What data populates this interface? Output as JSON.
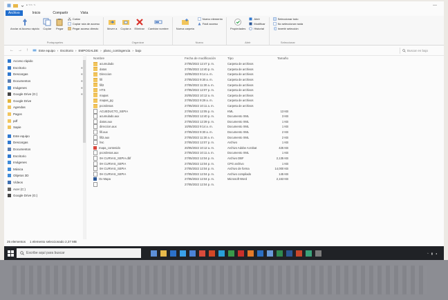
{
  "window": {
    "title": "• ~~ ~",
    "minimize_glyph": "—"
  },
  "tabs": [
    "Archivo",
    "Inicio",
    "Compartir",
    "Vista"
  ],
  "ribbon": {
    "clipboard": {
      "big": [
        "Anclar al Acceso rápido",
        "Copiar",
        "Pegar"
      ],
      "small": [
        "Cortar",
        "Copiar ruta de acceso",
        "Pegar acceso directo"
      ],
      "label": "Portapapeles"
    },
    "organize": {
      "big": [
        "Mover a",
        "Copiar a",
        "Eliminar",
        "Cambiar nombre"
      ],
      "label": "Organizar"
    },
    "new": {
      "big": [
        "Nueva carpeta"
      ],
      "small": [
        "Nuevo elemento",
        "Fácil acceso"
      ],
      "label": "Nuevo"
    },
    "open": {
      "big": [
        "Propiedades"
      ],
      "small": [
        "Abrir",
        "Modificar",
        "Historial"
      ],
      "label": "Abrir"
    },
    "select": {
      "small": [
        "Seleccionar todo",
        "No seleccionar nada",
        "Invertir selección"
      ],
      "label": "Seleccionar"
    }
  },
  "address": {
    "back": "←",
    "forward": "→",
    "up": "↑",
    "path": [
      "Este equipo",
      "Escritorio",
      "EMPOGALDE",
      "plano_contingencia",
      "bajo"
    ],
    "search_placeholder": "Buscar en bajo"
  },
  "nav": [
    {
      "label": "Acceso rápido",
      "icon": "star-icon",
      "color": "#2f78d0",
      "pinned": false
    },
    {
      "label": "Escritorio",
      "icon": "desktop-icon",
      "color": "#2f78d0",
      "pinned": true
    },
    {
      "label": "Descargas",
      "icon": "download-icon",
      "color": "#2f78d0",
      "pinned": true
    },
    {
      "label": "Documentos",
      "icon": "document-icon",
      "color": "#5a7fb5",
      "pinned": true
    },
    {
      "label": "Imágenes",
      "icon": "picture-icon",
      "color": "#3f8bd9",
      "pinned": true
    },
    {
      "label": "Google Drive (G:)",
      "icon": "drive-icon",
      "color": "#444",
      "pinned": true
    },
    {
      "label": "Google Drive",
      "icon": "google-drive-icon",
      "color": "#e4b43a",
      "pinned": false
    },
    {
      "label": "Agendas",
      "icon": "folder-icon",
      "color": "#f2c55c",
      "pinned": false
    },
    {
      "label": "Pagos",
      "icon": "folder-icon",
      "color": "#f2c55c",
      "pinned": false
    },
    {
      "label": "pdf",
      "icon": "folder-icon",
      "color": "#f2c55c",
      "pinned": false
    },
    {
      "label": "Sapie",
      "icon": "folder-icon",
      "color": "#f2c55c",
      "pinned": false
    },
    {
      "label": "Este equipo",
      "icon": "computer-icon",
      "color": "#2f78d0",
      "pinned": false
    },
    {
      "label": "Descargas",
      "icon": "download-icon",
      "color": "#2f78d0",
      "pinned": false
    },
    {
      "label": "Documentos",
      "icon": "document-icon",
      "color": "#5a7fb5",
      "pinned": false
    },
    {
      "label": "Escritorio",
      "icon": "desktop-icon",
      "color": "#2f78d0",
      "pinned": false
    },
    {
      "label": "Imágenes",
      "icon": "picture-icon",
      "color": "#3f8bd9",
      "pinned": false
    },
    {
      "label": "Música",
      "icon": "music-icon",
      "color": "#3f8bd9",
      "pinned": false
    },
    {
      "label": "Objetos 3D",
      "icon": "cube-icon",
      "color": "#3f8bd9",
      "pinned": false
    },
    {
      "label": "Vídeos",
      "icon": "video-icon",
      "color": "#3f6fb0",
      "pinned": false
    },
    {
      "label": "Acer (C:)",
      "icon": "disk-icon",
      "color": "#666",
      "pinned": false
    },
    {
      "label": "Google Drive (G:)",
      "icon": "drive-icon",
      "color": "#444",
      "pinned": false
    }
  ],
  "columns": {
    "name": "Nombre",
    "date": "Fecha de modificación",
    "type": "Tipo",
    "size": "Tamaño"
  },
  "files": [
    {
      "name": "acumulado",
      "date": "27/05/2022 12:47 p. m.",
      "type": "Carpeta de archivos",
      "size": "",
      "kind": "folder"
    },
    {
      "name": "datos",
      "date": "27/05/2022 12:40 p. m.",
      "type": "Carpeta de archivos",
      "size": "",
      "kind": "folder"
    },
    {
      "name": "Direccion",
      "date": "10/05/2022 9:14 a. m.",
      "type": "Carpeta de archivos",
      "size": "",
      "kind": "folder"
    },
    {
      "name": "fill",
      "date": "27/05/2022 9:30 a. m.",
      "type": "Carpeta de archivos",
      "size": "",
      "kind": "folder"
    },
    {
      "name": "fill2",
      "date": "27/05/2022 11:30 a. m.",
      "type": "Carpeta de archivos",
      "size": "",
      "kind": "folder"
    },
    {
      "name": "HTS",
      "date": "27/05/2022 12:07 p. m.",
      "type": "Carpeta de archivos",
      "size": "",
      "kind": "folder"
    },
    {
      "name": "mapas",
      "date": "20/05/2022 10:12 a. m.",
      "type": "Carpeta de archivos",
      "size": "",
      "kind": "folder"
    },
    {
      "name": "mapas_pg",
      "date": "27/05/2022 9:29 a. m.",
      "type": "Carpeta de archivos",
      "size": "",
      "kind": "folder"
    },
    {
      "name": "pcordenas",
      "date": "27/05/2022 10:11 a. m.",
      "type": "Carpeta de archivos",
      "size": "",
      "kind": "folder"
    },
    {
      "name": "ACUEDUCTO_SEPIA",
      "date": "27/05/2022 12:05 p. m.",
      "type": "KML",
      "size": "13 KB",
      "kind": "file"
    },
    {
      "name": "acumulado.aux",
      "date": "27/05/2022 12:40 p. m.",
      "type": "Documento XML",
      "size": "3 KB",
      "kind": "file"
    },
    {
      "name": "datos.aux",
      "date": "27/05/2022 12:39 p. m.",
      "type": "Documento XML",
      "size": "1 KB",
      "kind": "file"
    },
    {
      "name": "direccion.aux",
      "date": "10/05/2022 9:14 a. m.",
      "type": "Documento XML",
      "size": "1 KB",
      "kind": "file"
    },
    {
      "name": "fill.aux",
      "date": "27/05/2022 9:30 a. m.",
      "type": "Documento XML",
      "size": "2 KB",
      "kind": "file"
    },
    {
      "name": "fill2.aux",
      "date": "27/05/2022 11:30 a. m.",
      "type": "Documento XML",
      "size": "2 KB",
      "kind": "file"
    },
    {
      "name": "hsc",
      "date": "27/05/2022 12:07 p. m.",
      "type": "Archivo",
      "size": "1 KB",
      "kind": "file"
    },
    {
      "name": "mapa_contenido",
      "date": "20/05/2022 10:12 a. m.",
      "type": "Archivo Adobe Acrobat",
      "size": "425 KB",
      "kind": "pdf"
    },
    {
      "name": "pcordenas.aux",
      "date": "27/05/2022 10:11 a. m.",
      "type": "Documento XML",
      "size": "1 KB",
      "kind": "file"
    },
    {
      "name": "0H CURVAS_SEPIA.dbf",
      "date": "27/05/2022 12:04 p. m.",
      "type": "Archivo DBF",
      "size": "2,135 KB",
      "kind": "file"
    },
    {
      "name": "0H CURVAS_SEPIA",
      "date": "27/05/2022 12:04 p. m.",
      "type": "CPG archivo",
      "size": "1 KB",
      "kind": "file"
    },
    {
      "name": "0H CURVAS_SEPIA",
      "date": "27/05/2022 12:04 p. m.",
      "type": "Archivo de forma",
      "size": "14,000 KB",
      "kind": "file"
    },
    {
      "name": "0H CURVAS_SEPIA",
      "date": "27/05/2022 12:04 p. m.",
      "type": "Archivo compilado",
      "size": "145 KB",
      "kind": "file"
    },
    {
      "name": "Ox Mapa",
      "date": "27/05/2022 12:04 p. m.",
      "type": "Microsoft Word",
      "size": "2,163 KB",
      "kind": "word"
    },
    {
      "name": "",
      "date": "27/05/2022 12:04 p. m.",
      "type": "",
      "size": "",
      "kind": "file"
    }
  ],
  "status": {
    "count": "25 elementos",
    "selected": "1 elemento seleccionado  2,37 MB"
  },
  "taskbar": {
    "search_placeholder": "Escribe aquí para buscar",
    "apps": [
      {
        "icon": "task-view-icon",
        "color": "#5d8fd8"
      },
      {
        "icon": "explorer-icon",
        "color": "#e7b94b"
      },
      {
        "icon": "mail-icon",
        "color": "#2c71c9"
      },
      {
        "icon": "edge-icon",
        "color": "#3aa0e8"
      },
      {
        "icon": "store-icon",
        "color": "#4b83d6"
      },
      {
        "icon": "chrome-icon",
        "color": "#d94b3b"
      },
      {
        "icon": "office-icon",
        "color": "#d24726"
      },
      {
        "icon": "photos-icon",
        "color": "#2aa0d8"
      },
      {
        "icon": "earth-icon",
        "color": "#3a9a4a"
      },
      {
        "icon": "acrobat-icon",
        "color": "#c8302b"
      },
      {
        "icon": "firefox-icon",
        "color": "#e27a2a"
      },
      {
        "icon": "outlook-icon",
        "color": "#2b6fc2"
      },
      {
        "icon": "settings-icon",
        "color": "#6a9bd8"
      },
      {
        "icon": "excel-icon",
        "color": "#2f8a4f"
      },
      {
        "icon": "word-icon",
        "color": "#2b5797"
      },
      {
        "icon": "powerpoint-icon",
        "color": "#c9472b"
      },
      {
        "icon": "maps-icon",
        "color": "#3aa37a"
      },
      {
        "icon": "app-icon",
        "color": "#7b7b7b"
      }
    ]
  }
}
